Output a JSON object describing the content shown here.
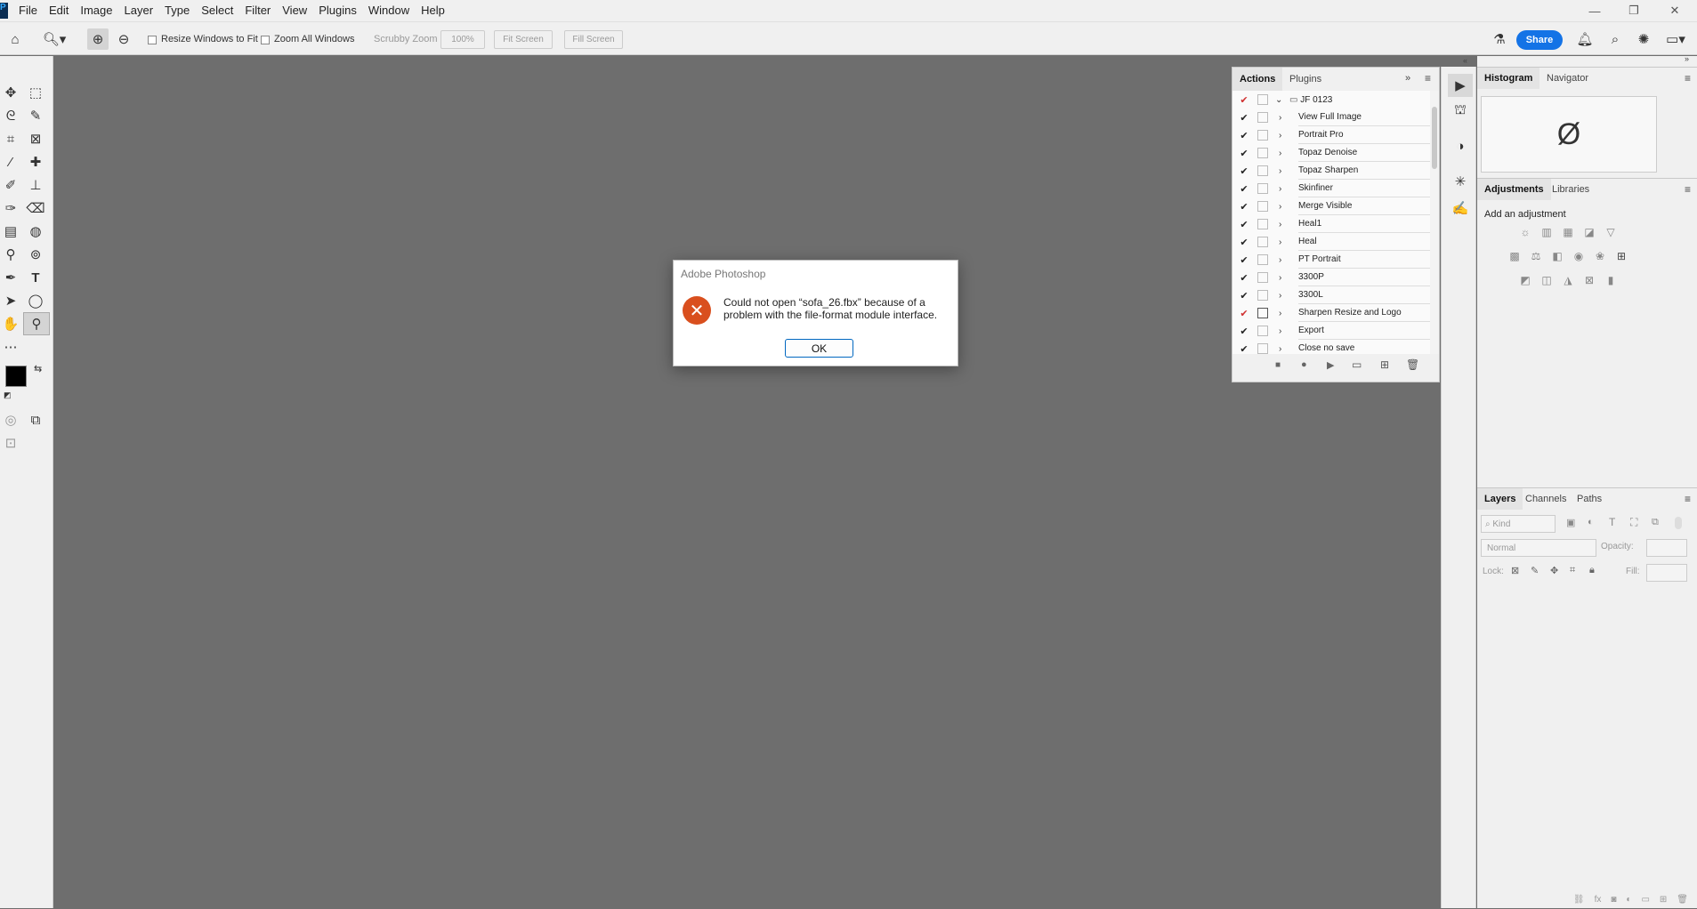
{
  "menu": [
    "File",
    "Edit",
    "Image",
    "Layer",
    "Type",
    "Select",
    "Filter",
    "View",
    "Plugins",
    "Window",
    "Help"
  ],
  "options": {
    "resize_windows": "Resize Windows to Fit",
    "zoom_all": "Zoom All Windows",
    "scrubby": "Scrubby Zoom",
    "zoom_pct": "100%",
    "fit_screen": "Fit Screen",
    "fill_screen": "Fill Screen",
    "share": "Share"
  },
  "actions_panel": {
    "tabs": [
      "Actions",
      "Plugins"
    ],
    "set_name": "JF 0123",
    "items": [
      "View Full Image",
      "Portrait Pro",
      "Topaz Denoise",
      "Topaz Sharpen",
      "Skinfiner",
      "Merge Visible",
      "Heal1",
      "Heal",
      "PT Portrait",
      "3300P",
      "3300L",
      "Sharpen Resize and Logo",
      "Export",
      "Close no save"
    ]
  },
  "histogram_panel": {
    "tabs": [
      "Histogram",
      "Navigator"
    ],
    "empty_symbol": "Ø"
  },
  "adjustments_panel": {
    "tabs": [
      "Adjustments",
      "Libraries"
    ],
    "hint": "Add an adjustment"
  },
  "layers_panel": {
    "tabs": [
      "Layers",
      "Channels",
      "Paths"
    ],
    "filter_placeholder": "Kind",
    "blend_mode": "Normal",
    "opacity_label": "Opacity:",
    "lock_label": "Lock:",
    "fill_label": "Fill:"
  },
  "dialog": {
    "title": "Adobe Photoshop",
    "message": "Could not open “sofa_26.fbx” because of a problem with the file-format module interface.",
    "ok": "OK"
  },
  "colors": {
    "accent": "#1473e6",
    "error": "#d94f1e",
    "canvas": "#6e6e6e"
  }
}
